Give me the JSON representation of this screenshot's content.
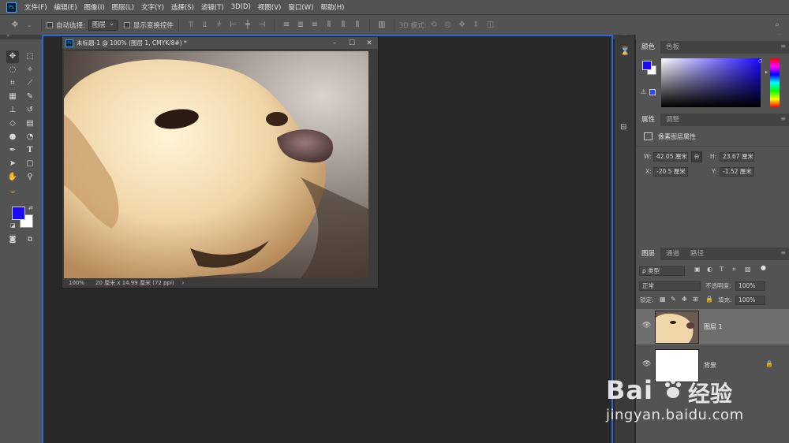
{
  "menu": {
    "logo": "Ps",
    "items": [
      "文件(F)",
      "编辑(E)",
      "图像(I)",
      "图层(L)",
      "文字(Y)",
      "选择(S)",
      "滤镜(T)",
      "3D(D)",
      "视图(V)",
      "窗口(W)",
      "帮助(H)"
    ]
  },
  "options": {
    "move_icon": "move-icon",
    "auto_select_label": "自动选择:",
    "auto_select_value": "图层",
    "show_transform_label": "显示变换控件",
    "mode_3d_label": "3D 模式:"
  },
  "document": {
    "icon": "Ps",
    "title": "未标题-1 @ 100% (图层 1, CMYK/8#) *",
    "zoom": "100%",
    "size": "20 厘米 x 14.99 厘米 (72 ppi)",
    "status_arrow": "›"
  },
  "color_panel": {
    "tab_color": "颜色",
    "tab_swatches": "色板",
    "foreground": "#1a0aff",
    "background": "#ffffff"
  },
  "properties_panel": {
    "tab_properties": "属性",
    "tab_adjust": "调整",
    "heading": "像素图层属性",
    "w_label": "W:",
    "w_value": "42.05 厘米",
    "h_label": "H:",
    "h_value": "23.67 厘米",
    "x_label": "X:",
    "x_value": "-20.5 厘米",
    "y_label": "Y:",
    "y_value": "-1.52 厘米"
  },
  "layers_panel": {
    "tab_layers": "图层",
    "tab_channels": "通道",
    "tab_paths": "路径",
    "filter_kind": "ρ 类型",
    "blend_mode": "正常",
    "opacity_label": "不透明度:",
    "opacity_value": "100%",
    "lock_label": "锁定:",
    "fill_label": "填充:",
    "fill_value": "100%",
    "layers": [
      {
        "name": "图层 1"
      },
      {
        "name": "背景"
      }
    ]
  },
  "watermark": {
    "brand_left": "Bai",
    "brand_right": "经验",
    "url": "jingyan.baidu.com"
  }
}
